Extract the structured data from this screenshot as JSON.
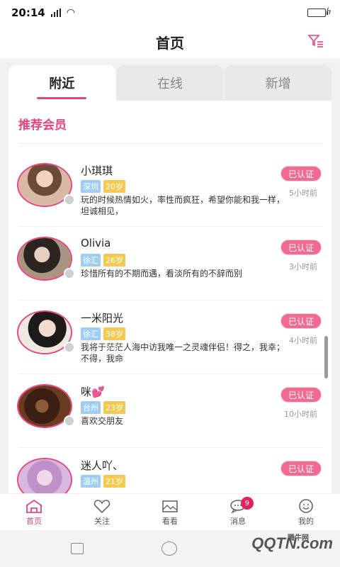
{
  "status_bar": {
    "time": "20:14",
    "wifi_icon": "wifi-icon",
    "battery_icon": "battery-icon"
  },
  "header": {
    "title": "首页",
    "filter_icon": "filter-icon"
  },
  "tabs": [
    {
      "label": "附近",
      "active": true
    },
    {
      "label": "在线",
      "active": false
    },
    {
      "label": "新增",
      "active": false
    }
  ],
  "section_title": "推荐会员",
  "members": [
    {
      "name": "小琪琪",
      "city": "深圳",
      "age": "20岁",
      "desc": "玩的时候热情如火，率性而疯狂，希望你能和我一样，坦诚相见，",
      "verified": "已认证",
      "time": "5小时前"
    },
    {
      "name": "Olivia",
      "city": "徐汇",
      "age": "26岁",
      "desc": "珍惜所有的不期而遇，看淡所有的不辞而别",
      "verified": "已认证",
      "time": "3小时前"
    },
    {
      "name": "一米阳光",
      "city": "徐汇",
      "age": "38岁",
      "desc": "我将于茫茫人海中访我唯一之灵魂伴侣！得之，我幸；不得，我命",
      "verified": "已认证",
      "time": "4小时前"
    },
    {
      "name": "咪💕",
      "city": "台州",
      "age": "23岁",
      "desc": "喜欢交朋友",
      "verified": "已认证",
      "time": "10小时前"
    },
    {
      "name": "迷人吖、",
      "city": "温州",
      "age": "21岁",
      "desc": "",
      "verified": "已认证",
      "time": ""
    }
  ],
  "bottom_nav": [
    {
      "label": "首页",
      "icon": "home-icon",
      "active": true
    },
    {
      "label": "关注",
      "icon": "heart-icon",
      "active": false
    },
    {
      "label": "看看",
      "icon": "photos-icon",
      "active": false
    },
    {
      "label": "消息",
      "icon": "message-icon",
      "active": false,
      "badge": "9"
    },
    {
      "label": "我的",
      "icon": "profile-icon",
      "active": false
    }
  ],
  "watermark": {
    "small": "腾牛网",
    "big": "QQTN.com"
  },
  "colors": {
    "accent": "#e8457a",
    "verified_bg": "#f06a92",
    "city_tag": "#9ecdf2",
    "age_tag": "#f5c84f"
  }
}
